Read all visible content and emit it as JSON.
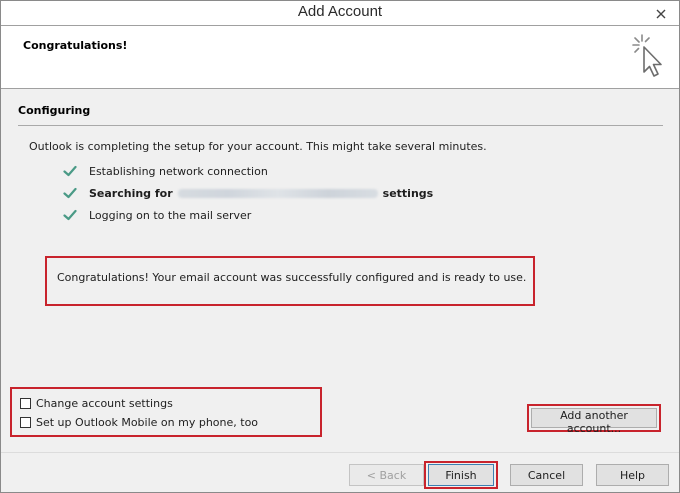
{
  "window": {
    "title": "Add Account",
    "close_icon": "close-icon"
  },
  "header": {
    "title": "Congratulations!",
    "icon": "cursor-click-icon"
  },
  "section": {
    "title": "Configuring",
    "intro": "Outlook is completing the setup for your account. This might take several minutes."
  },
  "steps": [
    {
      "label": "Establishing network connection",
      "status": "done"
    },
    {
      "label_prefix": "Searching for",
      "label_suffix": "settings",
      "status": "done"
    },
    {
      "label": "Logging on to the mail server",
      "status": "done"
    }
  ],
  "message": "Congratulations! Your email account was successfully configured and is ready to use.",
  "options": [
    {
      "label": "Change account settings",
      "checked": false
    },
    {
      "label": "Set up Outlook Mobile on my phone, too",
      "checked": false
    }
  ],
  "buttons": {
    "add_another": "Add another account...",
    "back": "< Back",
    "finish": "Finish",
    "cancel": "Cancel",
    "help": "Help"
  },
  "colors": {
    "check": "#4a9a86",
    "highlight": "#c8232c"
  }
}
